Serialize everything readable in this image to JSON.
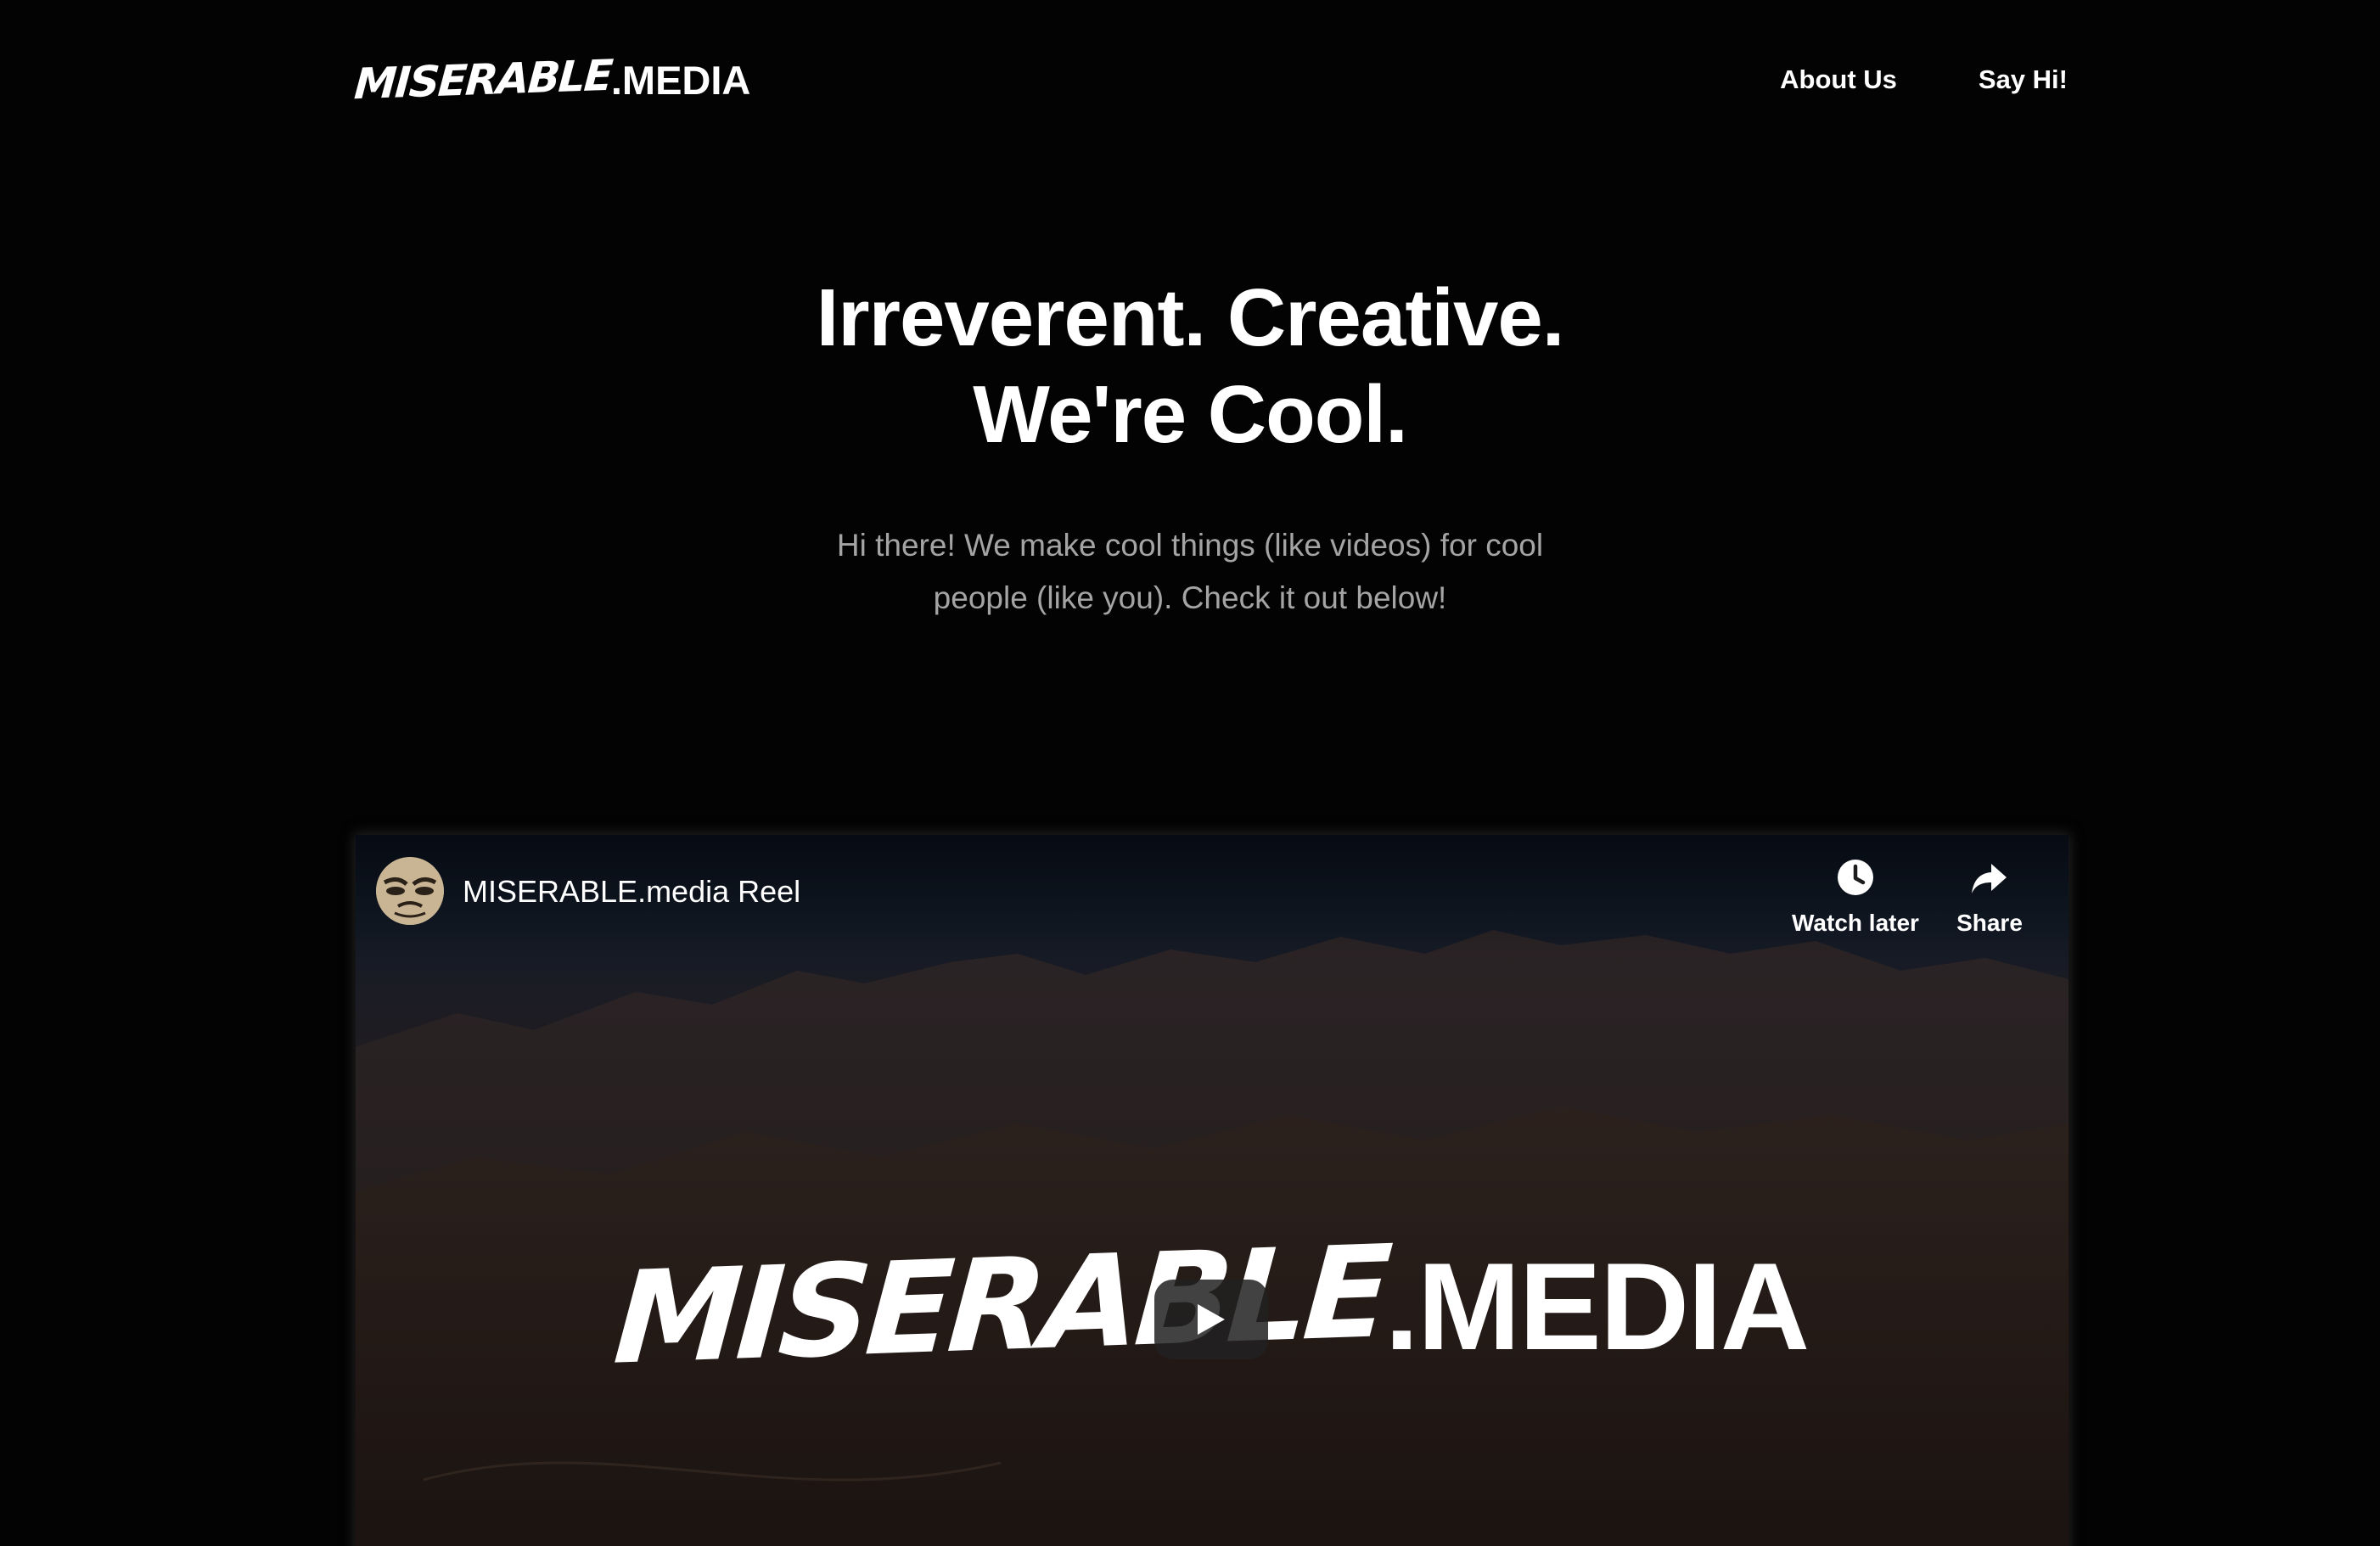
{
  "nav": {
    "logo_brush": "MISERABLE",
    "logo_rest": ".MEDIA",
    "links": [
      {
        "label": "About Us"
      },
      {
        "label": "Say Hi!"
      }
    ]
  },
  "hero": {
    "headline_line1": "Irreverent. Creative.",
    "headline_line2": "We're Cool.",
    "subtext": "Hi there! We make cool things (like videos) for cool people (like you). Check it out below!"
  },
  "video": {
    "title": "MISERABLE.media Reel",
    "actions": {
      "watch_later": "Watch later",
      "share": "Share"
    },
    "overlay_logo_brush": "MISERABLE",
    "overlay_logo_rest": ".MEDIA",
    "icons": {
      "avatar": "channel-avatar-face",
      "watch_later": "clock-icon",
      "share": "share-arrow-icon",
      "play": "play-icon"
    }
  },
  "colors": {
    "background": "#030303",
    "text": "#ffffff",
    "subtext": "#a4a4a4"
  }
}
